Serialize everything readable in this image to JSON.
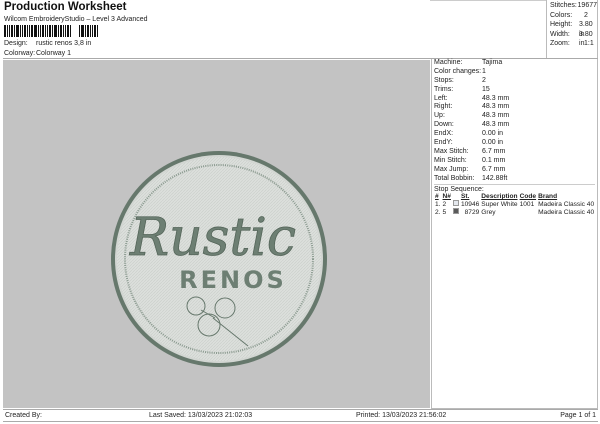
{
  "header": {
    "title": "Production Worksheet",
    "subtitle": "Wilcom EmbroideryStudio – Level 3 Advanced",
    "design_label": "Design:",
    "design_value": "rustic renos 3,8 in",
    "colorway_label": "Colorway:",
    "colorway_value": "Colorway 1"
  },
  "stats": [
    {
      "k": "Stitches:",
      "v": "19677"
    },
    {
      "k": "Colors:",
      "v": "2"
    },
    {
      "k": "Height:",
      "v": "3.80 in"
    },
    {
      "k": "Width:",
      "v": "3.80 in"
    },
    {
      "k": "Zoom:",
      "v": "1:1"
    }
  ],
  "details": [
    {
      "k": "Machine:",
      "v": "Tajima"
    },
    {
      "k": "Color changes:",
      "v": "1"
    },
    {
      "k": "Stops:",
      "v": "2"
    },
    {
      "k": "Trims:",
      "v": "15"
    },
    {
      "k": "Left:",
      "v": "48.3 mm"
    },
    {
      "k": "Right:",
      "v": "48.3 mm"
    },
    {
      "k": "Up:",
      "v": "48.3 mm"
    },
    {
      "k": "Down:",
      "v": "48.3 mm"
    },
    {
      "k": "EndX:",
      "v": "0.00 in"
    },
    {
      "k": "EndY:",
      "v": "0.00 in"
    },
    {
      "k": "Max Stitch:",
      "v": "6.7 mm"
    },
    {
      "k": "Min Stitch:",
      "v": "0.1 mm"
    },
    {
      "k": "Max Jump:",
      "v": "6.7 mm"
    },
    {
      "k": "Total Bobbin:",
      "v": "142.88ft"
    }
  ],
  "stop_sequence": {
    "label": "Stop Sequence:",
    "headers": [
      "#",
      "N#",
      "",
      "St.",
      "Description",
      "Code",
      "Brand"
    ],
    "rows": [
      {
        "n": "1.",
        "needle": "2",
        "color": "#e4e8ee",
        "st": "10946",
        "desc": "Super White",
        "code": "1001",
        "brand": "Madeira Classic 40"
      },
      {
        "n": "2.",
        "needle": "5",
        "color": "#5a5a5a",
        "st": "8729",
        "desc": "Grey",
        "code": "",
        "brand": "Madeira Classic 40"
      }
    ]
  },
  "logo": {
    "script": "Rustic",
    "block": "RENOS"
  },
  "footer": {
    "created": "Created By:",
    "saved": "Last Saved: 13/03/2023 21:02:03",
    "printed": "Printed: 13/03/2023 21:56:02",
    "page": "Page 1 of 1"
  }
}
